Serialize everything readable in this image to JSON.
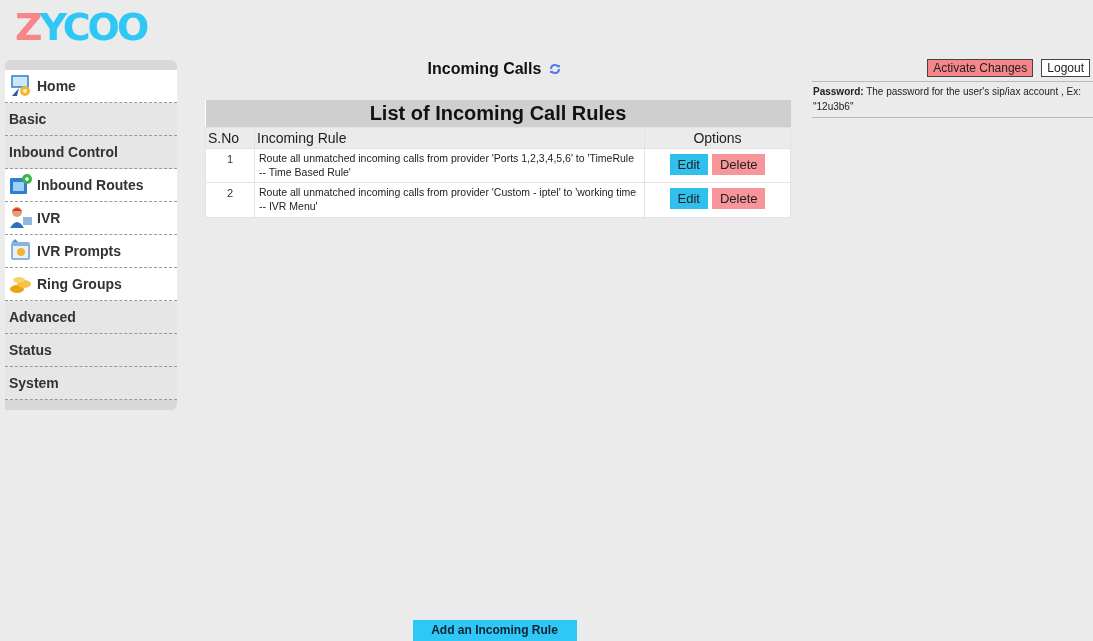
{
  "logo": {
    "left": "Z",
    "right": "YCOO"
  },
  "sidebar": {
    "items": [
      {
        "label": "Home",
        "kind": "link"
      },
      {
        "label": "Basic",
        "kind": "heading"
      },
      {
        "label": "Inbound Control",
        "kind": "heading"
      },
      {
        "label": "Inbound Routes",
        "kind": "link"
      },
      {
        "label": "IVR",
        "kind": "link"
      },
      {
        "label": "IVR Prompts",
        "kind": "link"
      },
      {
        "label": "Ring Groups",
        "kind": "link"
      },
      {
        "label": "Advanced",
        "kind": "heading"
      },
      {
        "label": "Status",
        "kind": "heading"
      },
      {
        "label": "System",
        "kind": "heading"
      }
    ]
  },
  "page_title": "Incoming Calls",
  "table": {
    "title": "List of Incoming Call Rules",
    "columns": [
      "S.No",
      "Incoming Rule",
      "Options"
    ],
    "rows": [
      {
        "sno": "1",
        "rule": "Route all unmatched incoming calls from provider 'Ports 1,2,3,4,5,6' to 'TimeRule -- Time Based Rule'",
        "actions": [
          "Edit",
          "Delete"
        ]
      },
      {
        "sno": "2",
        "rule": "Route all unmatched incoming calls from provider 'Custom - iptel' to 'working time -- IVR Menu'",
        "actions": [
          "Edit",
          "Delete"
        ]
      }
    ]
  },
  "add_button": "Add an Incoming Rule",
  "top_buttons": [
    "Activate Changes",
    "Logout"
  ],
  "help": {
    "term": "Password:",
    "text": "The password for the user's sip/iax account , Ex: \"12u3b6\""
  }
}
